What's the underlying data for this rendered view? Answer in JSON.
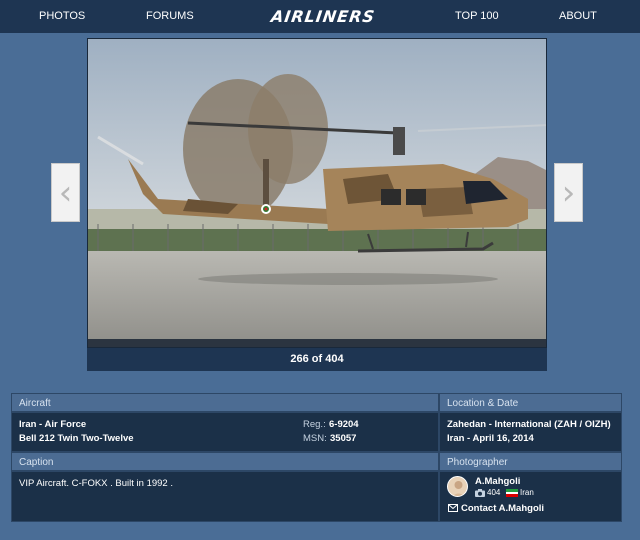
{
  "nav": {
    "photos": "PHOTOS",
    "forums": "FORUMS",
    "brand": "AIRLINERS",
    "top100": "TOP 100",
    "about": "ABOUT"
  },
  "photo": {
    "counter": "266 of 404",
    "prev_icon": "chevron-left-icon",
    "next_icon": "chevron-right-icon"
  },
  "aircraft": {
    "header": "Aircraft",
    "operator": "Iran - Air Force",
    "model": "Bell 212 Twin Two-Twelve",
    "reg_label": "Reg.:",
    "reg": "6-9204",
    "msn_label": "MSN:",
    "msn": "35057"
  },
  "location": {
    "header": "Location & Date",
    "airport": "Zahedan - International (ZAH / OIZH)",
    "date": "Iran - April 16, 2014"
  },
  "caption": {
    "header": "Caption",
    "text": "VIP Aircraft. C-FOKX . Built in 1992 ."
  },
  "photographer": {
    "header": "Photographer",
    "name": "A.Mahgoli",
    "photo_count": "404",
    "country": "Iran",
    "contact": "Contact A.Mahgoli"
  },
  "colors": {
    "background": "#4a6d96",
    "nav": "#1e3552",
    "panel": "#1b3048",
    "panel_header": "#4c6c93"
  }
}
